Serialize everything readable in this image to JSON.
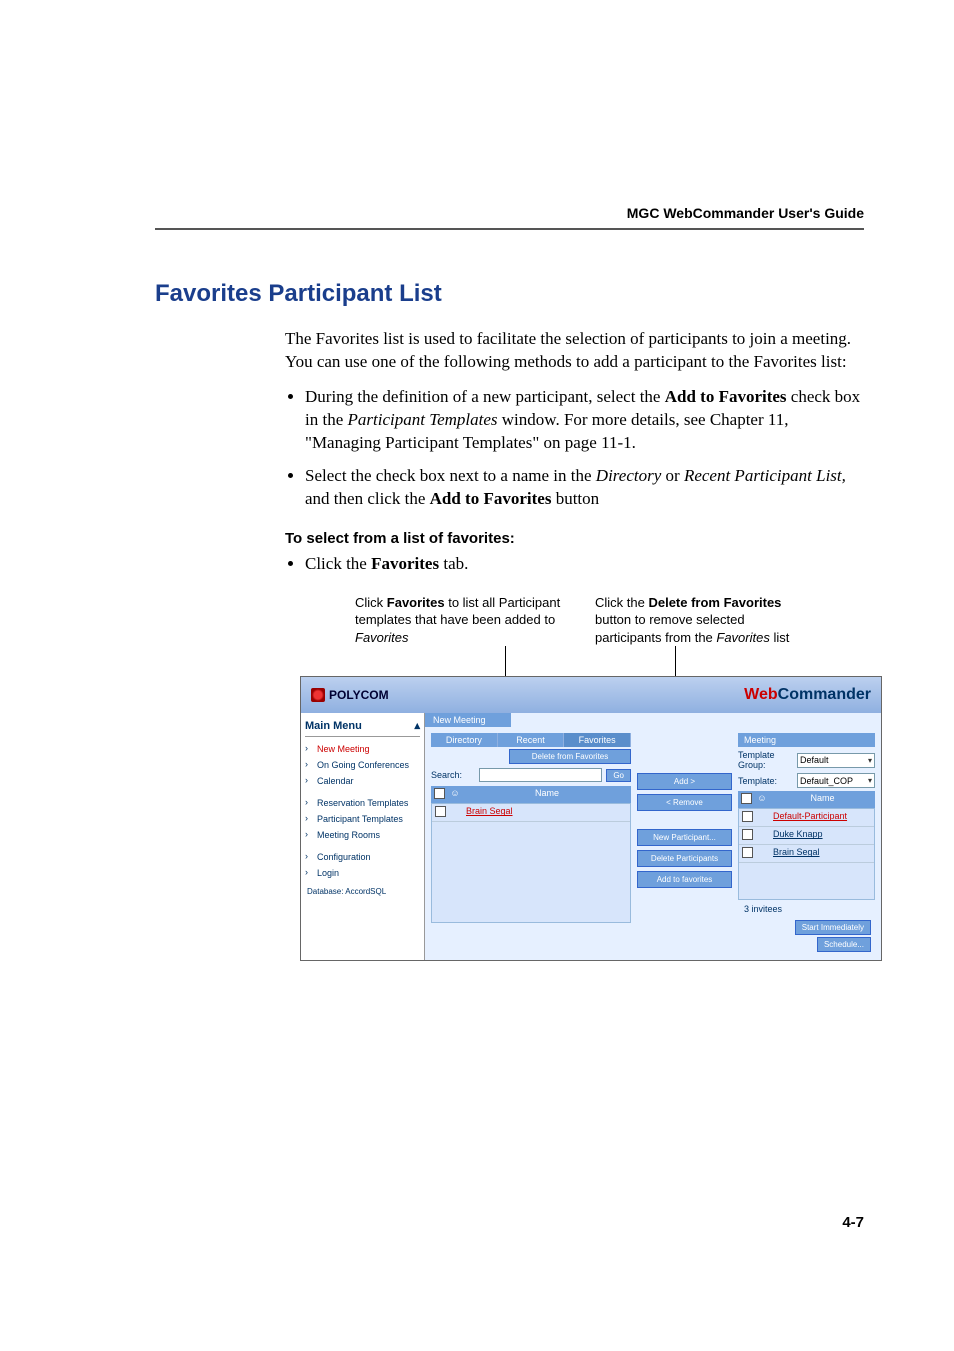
{
  "header": {
    "guide": "MGC WebCommander User's Guide"
  },
  "section_title": "Favorites Participant List",
  "intro": "The Favorites list is used to facilitate the selection of participants to join a meeting. You can use one of the following methods to add a participant to the Favorites list:",
  "bullets": [
    {
      "pre": "During the definition of a new participant, select the ",
      "bold1": "Add to Favorites",
      "mid": " check box in the ",
      "ital": "Participant Templates",
      "post": " window. For more details, see Chapter  11, \"Managing Participant Templates\" on page 11-1."
    },
    {
      "pre": "Select the check box next to a name in the ",
      "ital1": "Directory",
      "mid1": " or ",
      "ital2": "Recent Participant List,",
      "mid2": " and then click the ",
      "bold1": "Add to Favorites",
      "post": " button"
    }
  ],
  "subhead": "To select from a list of favorites:",
  "step": {
    "pre": "Click the ",
    "bold": "Favorites",
    "post": " tab."
  },
  "callouts": {
    "left": {
      "l1": "Click ",
      "b1": "Favorites",
      "l2": " to list all Participant templates that have been added to ",
      "i1": "Favorites"
    },
    "right": {
      "l1": "Click the ",
      "b1": "Delete from Favorites",
      "l2": " button to remove selected participants from the ",
      "i1": "Favorites",
      "l3": " list"
    }
  },
  "shot": {
    "brand": "POLYCOM",
    "web": "Web",
    "commander": "Commander",
    "main_menu": "Main Menu",
    "nav": {
      "new_meeting": "New Meeting",
      "ongoing": "On Going Conferences",
      "calendar": "Calendar",
      "res_templates": "Reservation Templates",
      "part_templates": "Participant Templates",
      "meeting_rooms": "Meeting Rooms",
      "configuration": "Configuration",
      "login": "Login",
      "database": "Database: AccordSQL"
    },
    "new_meeting_tab": "New Meeting",
    "tabs": {
      "directory": "Directory",
      "recent": "Recent",
      "favorites": "Favorites"
    },
    "delete_from_favorites": "Delete from Favorites",
    "search_label": "Search:",
    "go": "Go",
    "col_name": "Name",
    "left_rows": [
      "Brain Segal"
    ],
    "mid_buttons": {
      "add": "Add >",
      "remove": "< Remove",
      "new_participant": "New Participant...",
      "delete_participants": "Delete Participants",
      "add_to_favorites": "Add to favorites"
    },
    "meeting_title": "Meeting",
    "template_group": "Template Group:",
    "template": "Template:",
    "tg_value": "Default",
    "t_value": "Default_COP",
    "right_rows": [
      "Default-Participant",
      "Duke Knapp",
      "Brain Segal"
    ],
    "invitees": "3 invitees",
    "start_immediately": "Start Immediately",
    "schedule": "Schedule..."
  },
  "page_number": "4-7"
}
